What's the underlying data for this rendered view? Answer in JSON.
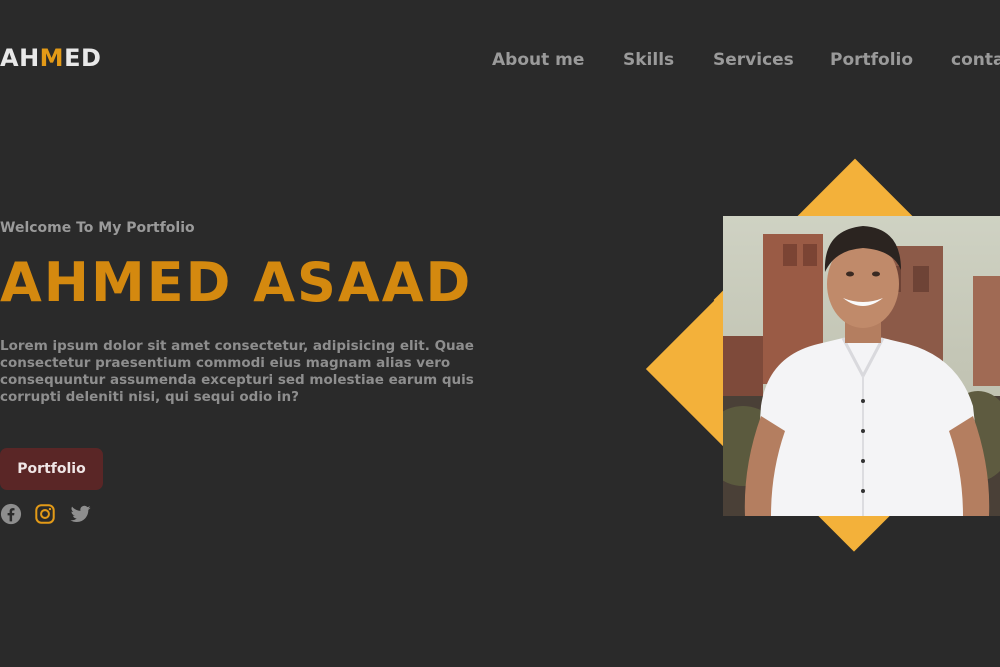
{
  "brand": {
    "logo_part1": "AH",
    "logo_accent": "M",
    "logo_part2": "ED"
  },
  "nav": {
    "items": [
      {
        "label": "About me"
      },
      {
        "label": "Skills"
      },
      {
        "label": "Services"
      },
      {
        "label": "Portfolio"
      },
      {
        "label": "contact"
      }
    ]
  },
  "hero": {
    "welcome": "Welcome To My Portfolio",
    "name": "AHMED ASAAD",
    "description": "Lorem ipsum dolor sit amet consectetur, adipisicing elit. Quae consectetur praesentium commodi eius magnam alias vero consequuntur assumenda excepturi sed molestiae earum quis corrupti deleniti nisi, qui sequi odio in?",
    "button_label": "Portfolio"
  },
  "socials": [
    {
      "icon": "facebook-icon",
      "color": "#8e8e8e"
    },
    {
      "icon": "instagram-icon",
      "color": "#e39a17"
    },
    {
      "icon": "twitter-icon",
      "color": "#8e8e8e"
    }
  ],
  "colors": {
    "background": "#2a2a2a",
    "accent": "#d4890f",
    "diamond": "#f3b13a",
    "button": "#5a2626",
    "muted_text": "#9a9a9a"
  }
}
